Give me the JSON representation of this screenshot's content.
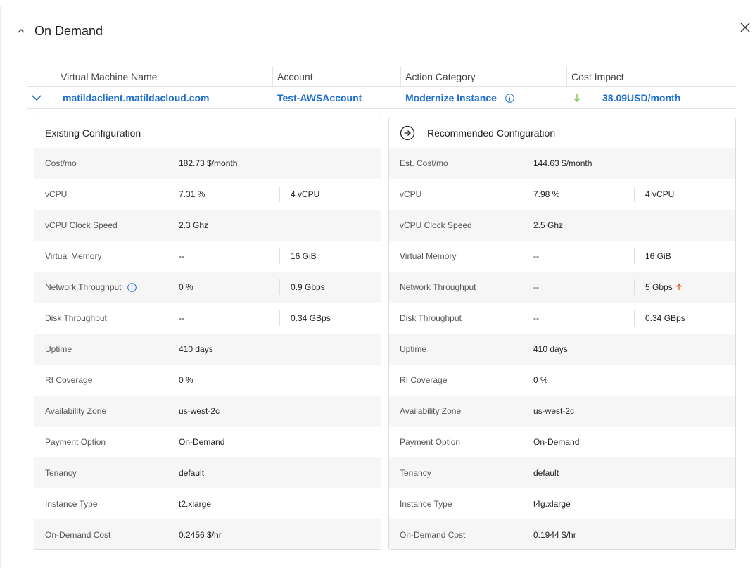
{
  "header": {
    "title": "On Demand"
  },
  "summary": {
    "columns": [
      "Virtual Machine Name",
      "Account",
      "Action Category",
      "Cost Impact"
    ],
    "row": {
      "vm_name": "matildaclient.matildacloud.com",
      "account": "Test-AWSAccount",
      "action_category": "Modernize Instance",
      "cost_impact": "38.09USD/month"
    }
  },
  "existing": {
    "title": "Existing Configuration",
    "rows": [
      {
        "label": "Cost/mo",
        "value": "182.73 $/month",
        "extra": ""
      },
      {
        "label": "vCPU",
        "value": "7.31 %",
        "extra": "4 vCPU"
      },
      {
        "label": "vCPU Clock Speed",
        "value": "2.3 Ghz",
        "extra": ""
      },
      {
        "label": "Virtual Memory",
        "value": "--",
        "extra": "16 GiB"
      },
      {
        "label": "Network Throughput",
        "value": "0 %",
        "extra": "0.9 Gbps"
      },
      {
        "label": "Disk Throughput",
        "value": "--",
        "extra": "0.34 GBps"
      },
      {
        "label": "Uptime",
        "value": "410 days",
        "extra": ""
      },
      {
        "label": "RI Coverage",
        "value": "0 %",
        "extra": ""
      },
      {
        "label": "Availability Zone",
        "value": "us-west-2c",
        "extra": ""
      },
      {
        "label": "Payment Option",
        "value": "On-Demand",
        "extra": ""
      },
      {
        "label": "Tenancy",
        "value": "default",
        "extra": ""
      },
      {
        "label": "Instance Type",
        "value": "t2.xlarge",
        "extra": ""
      },
      {
        "label": "On-Demand Cost",
        "value": "0.2456 $/hr",
        "extra": ""
      }
    ]
  },
  "recommended": {
    "title": "Recommended Configuration",
    "rows": [
      {
        "label": "Est. Cost/mo",
        "value": "144.63 $/month",
        "extra": ""
      },
      {
        "label": "vCPU",
        "value": "7.98 %",
        "extra": "4 vCPU"
      },
      {
        "label": "vCPU Clock Speed",
        "value": "2.5 Ghz",
        "extra": ""
      },
      {
        "label": "Virtual Memory",
        "value": "--",
        "extra": "16 GiB"
      },
      {
        "label": "Network Throughput",
        "value": "--",
        "extra": "5 Gbps"
      },
      {
        "label": "Disk Throughput",
        "value": "--",
        "extra": "0.34 GBps"
      },
      {
        "label": "Uptime",
        "value": "410 days",
        "extra": ""
      },
      {
        "label": "RI Coverage",
        "value": "0 %",
        "extra": ""
      },
      {
        "label": "Availability Zone",
        "value": "us-west-2c",
        "extra": ""
      },
      {
        "label": "Payment Option",
        "value": "On-Demand",
        "extra": ""
      },
      {
        "label": "Tenancy",
        "value": "default",
        "extra": ""
      },
      {
        "label": "Instance Type",
        "value": "t4g.xlarge",
        "extra": ""
      },
      {
        "label": "On-Demand Cost",
        "value": "0.1944 $/hr",
        "extra": ""
      }
    ]
  },
  "colors": {
    "link": "#1e6fd0",
    "decrease": "#6cbf3f",
    "increase": "#e0531f"
  },
  "icons": [
    "chevron-up-icon",
    "close-icon",
    "chevron-down-icon",
    "info-icon",
    "arrow-down-icon",
    "circle-arrow-right-icon",
    "arrow-up-icon"
  ]
}
